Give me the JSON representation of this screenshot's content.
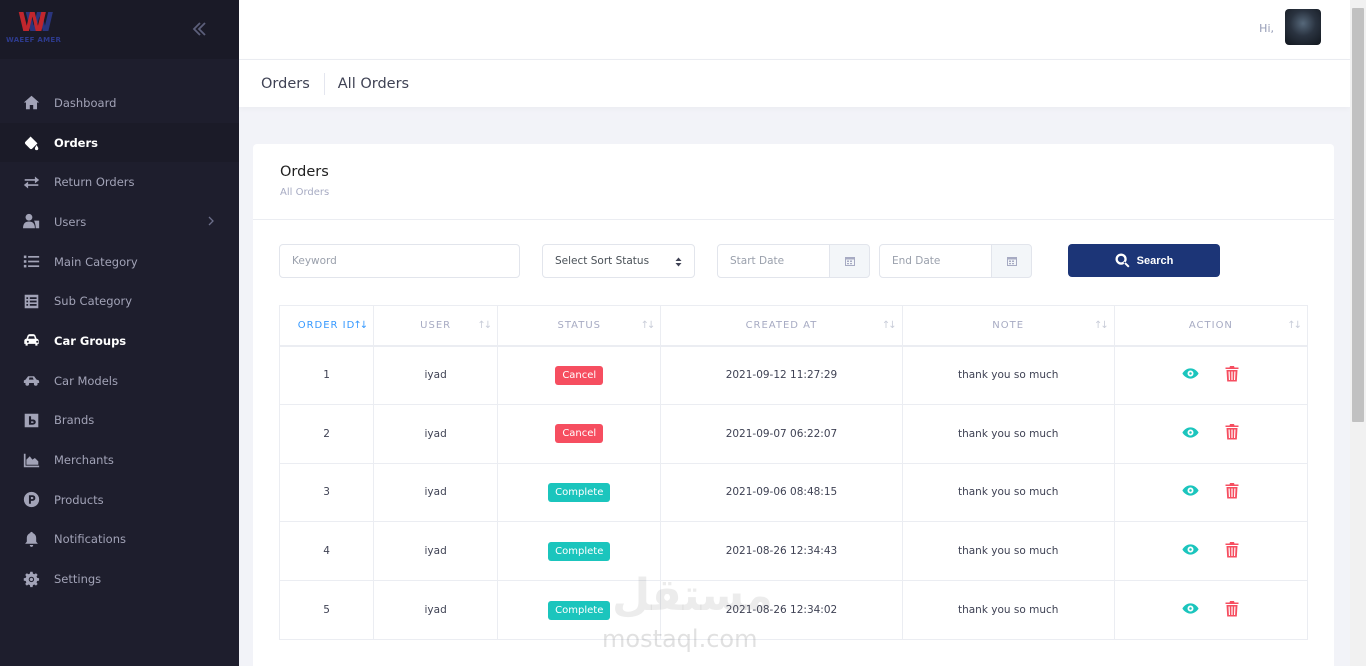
{
  "brand": {
    "logo_letter": "W",
    "logo_text": "WAEEF AMER"
  },
  "sidebar": {
    "items": [
      {
        "label": "Dashboard",
        "icon": "home-icon"
      },
      {
        "label": "Orders",
        "icon": "paint-bucket-icon",
        "active": true
      },
      {
        "label": "Return Orders",
        "icon": "exchange-icon"
      },
      {
        "label": "Users",
        "icon": "users-icon",
        "has_submenu": true
      },
      {
        "label": "Main Category",
        "icon": "list-icon"
      },
      {
        "label": "Sub Category",
        "icon": "list-alt-icon"
      },
      {
        "label": "Car Groups",
        "icon": "car-icon",
        "bold": true
      },
      {
        "label": "Car Models",
        "icon": "car-side-icon"
      },
      {
        "label": "Brands",
        "icon": "brand-icon"
      },
      {
        "label": "Merchants",
        "icon": "chart-area-icon"
      },
      {
        "label": "Products",
        "icon": "product-p-icon"
      },
      {
        "label": "Notifications",
        "icon": "bell-icon"
      },
      {
        "label": "Settings",
        "icon": "gear-icon"
      }
    ]
  },
  "header": {
    "greeting": "Hi,"
  },
  "subheader": {
    "title": "Orders",
    "breadcrumb": "All Orders"
  },
  "card": {
    "title": "Orders",
    "subtitle": "All Orders"
  },
  "filters": {
    "keyword_placeholder": "Keyword",
    "sort_status_label": "Select Sort Status",
    "start_date_placeholder": "Start Date",
    "end_date_placeholder": "End Date",
    "search_label": "Search"
  },
  "table": {
    "columns": [
      "ORDER ID",
      "USER",
      "STATUS",
      "CREATED AT",
      "NOTE",
      "ACTION"
    ],
    "rows": [
      {
        "id": "1",
        "user": "iyad",
        "status": "Cancel",
        "created_at": "2021-09-12 11:27:29",
        "note": "thank you so much"
      },
      {
        "id": "2",
        "user": "iyad",
        "status": "Cancel",
        "created_at": "2021-09-07 06:22:07",
        "note": "thank you so much"
      },
      {
        "id": "3",
        "user": "iyad",
        "status": "Complete",
        "created_at": "2021-09-06 08:48:15",
        "note": "thank you so much"
      },
      {
        "id": "4",
        "user": "iyad",
        "status": "Complete",
        "created_at": "2021-08-26 12:34:43",
        "note": "thank you so much"
      },
      {
        "id": "5",
        "user": "iyad",
        "status": "Complete",
        "created_at": "2021-08-26 12:34:02",
        "note": "thank you so much"
      }
    ]
  },
  "colors": {
    "sidebar_bg": "#1e1e2d",
    "primary": "#1c3577",
    "cancel": "#f64e60",
    "complete": "#1bc5bd",
    "sort_active": "#3699ff"
  },
  "watermark": {
    "arabic": "مستقل",
    "latin": "mostaql.com"
  }
}
